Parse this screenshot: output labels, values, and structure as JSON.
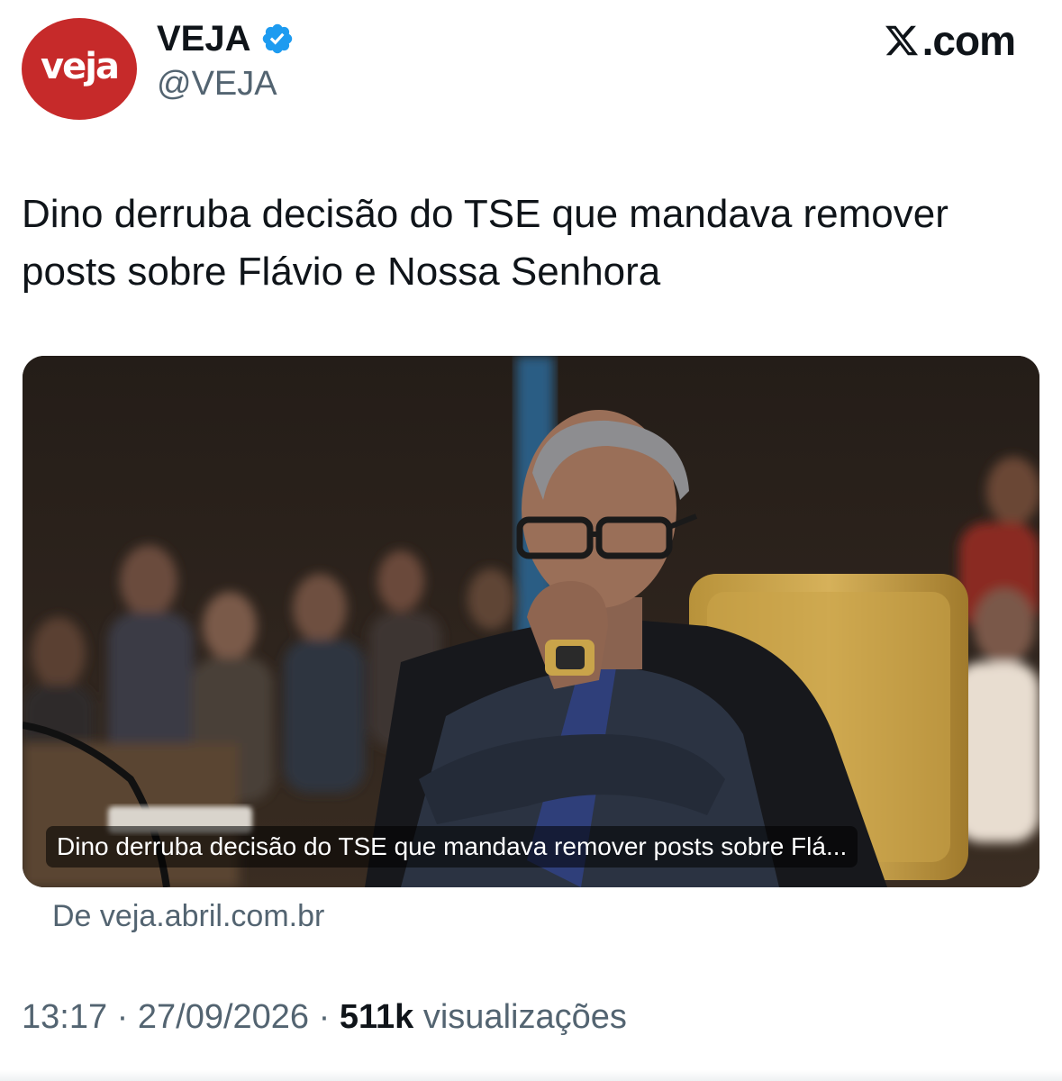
{
  "author": {
    "avatar_text": "veja",
    "display_name": "VEJA",
    "handle": "@VEJA",
    "verified": true
  },
  "brand": {
    "site_text": ".com",
    "logo_icon": "x-logo-icon"
  },
  "tweet": {
    "text": "Dino derruba decisão do TSE que mandava remover posts sobre Flávio e Nossa Senhora"
  },
  "link_card": {
    "caption": "Dino derruba decisão do TSE que mandava remover posts sobre Flá...",
    "source": "De veja.abril.com.br"
  },
  "meta": {
    "time": "13:17",
    "separator": "·",
    "date": "27/09/2026",
    "views_count": "511k",
    "views_label": "visualizações"
  },
  "colors": {
    "avatar_bg": "#c62a2a",
    "verified_blue": "#1d9bf0",
    "secondary_text": "#536471",
    "primary_text": "#0f1419"
  }
}
